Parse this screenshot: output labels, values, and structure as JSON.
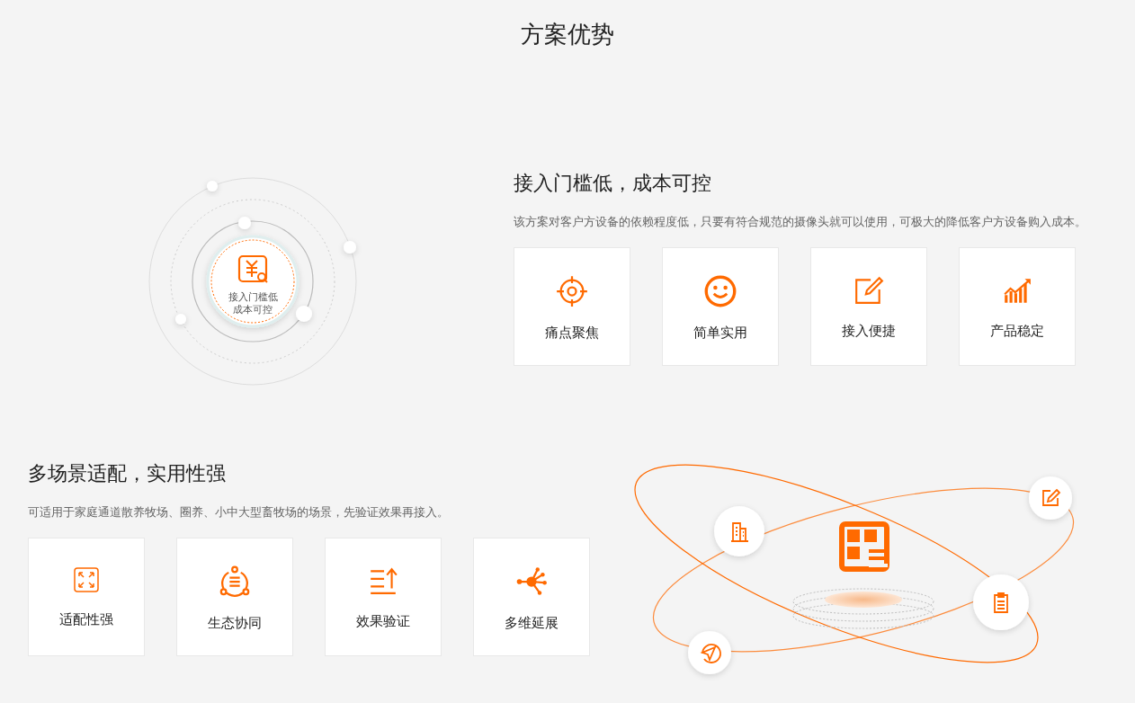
{
  "page_title": "方案优势",
  "sections": [
    {
      "title": "接入门槛低，成本可控",
      "description": "该方案对客户方设备的依赖程度低，只要有符合规范的摄像头就可以使用，可极大的降低客户方设备购入成本。",
      "illustration": {
        "kind": "orbit",
        "center_label": "接入门槛低成本可控"
      },
      "features": [
        {
          "label": "痛点聚焦"
        },
        {
          "label": "简单实用"
        },
        {
          "label": "接入便捷"
        },
        {
          "label": "产品稳定"
        }
      ]
    },
    {
      "title": "多场景适配，实用性强",
      "description": "可适用于家庭通道散养牧场、圈养、小中大型畜牧场的场景，先验证效果再接入。",
      "illustration": {
        "kind": "platform"
      },
      "features": [
        {
          "label": "适配性强"
        },
        {
          "label": "生态协同"
        },
        {
          "label": "效果验证"
        },
        {
          "label": "多维延展"
        }
      ]
    }
  ]
}
